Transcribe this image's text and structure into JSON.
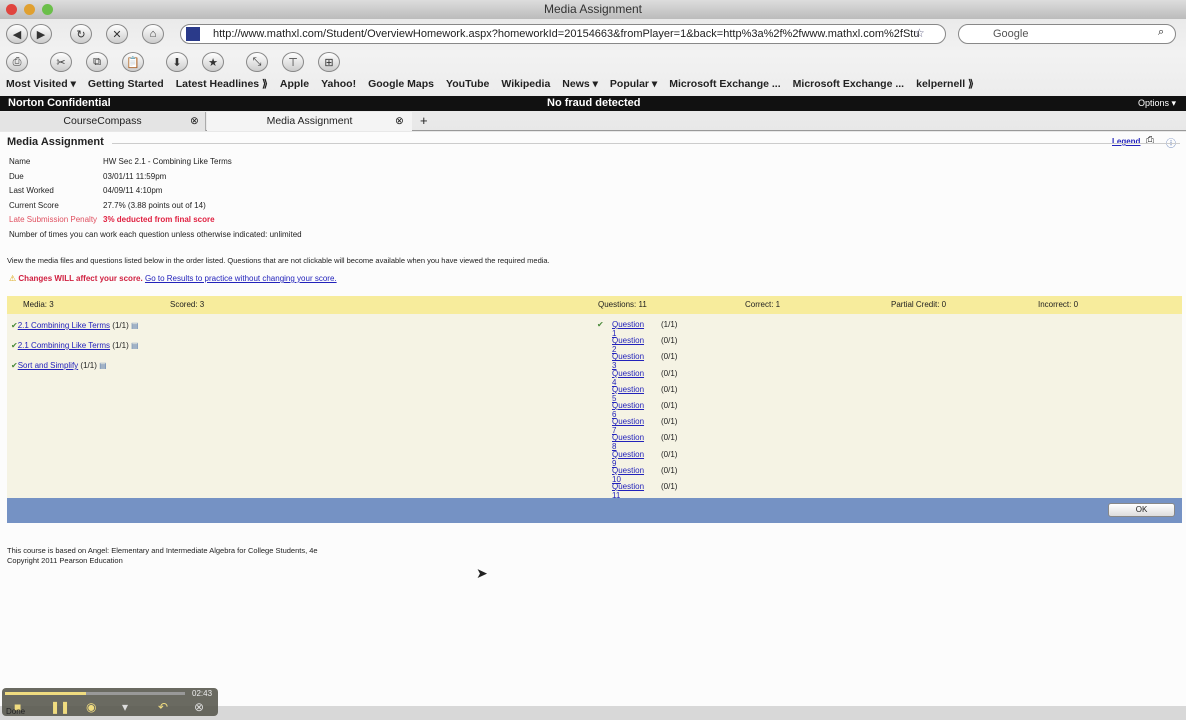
{
  "window": {
    "title": "Media Assignment"
  },
  "nav": {
    "url": "http://www.mathxl.com/Student/OverviewHomework.aspx?homeworkId=20154663&fromPlayer=1&back=http%3a%2f%2fwww.mathxl.com%2fStu",
    "search_placeholder": "Google"
  },
  "bookmarks": [
    "Most Visited ▾",
    "Getting Started",
    "Latest Headlines ⟫",
    "Apple",
    "Yahoo!",
    "Google Maps",
    "YouTube",
    "Wikipedia",
    "News ▾",
    "Popular ▾",
    "Microsoft Exchange ...",
    "Microsoft Exchange ...",
    "kelpernell ⟫"
  ],
  "norton": {
    "title": "Norton Confidential",
    "status": "No fraud detected",
    "options": "Options ▾"
  },
  "tabs": [
    {
      "label": "CourseCompass"
    },
    {
      "label": "Media Assignment"
    }
  ],
  "page": {
    "title": "Media Assignment",
    "legend": "Legend",
    "details": [
      {
        "label": "Name",
        "value": "HW Sec 2.1 - Combining Like Terms"
      },
      {
        "label": "Due",
        "value": "03/01/11 11:59pm"
      },
      {
        "label": "Last Worked",
        "value": "04/09/11 4:10pm"
      },
      {
        "label": "Current Score",
        "value": "27.7% (3.88 points out of 14)"
      },
      {
        "label": "Late Submission Penalty",
        "value": "3% deducted from final score"
      }
    ],
    "attempts": "Number of times you can work each question unless otherwise indicated: unlimited",
    "instructions": "View the media files and questions listed below in the order listed.  Questions that are not clickable will become available when you have viewed the required media.",
    "warning": "Changes WILL affect your score.",
    "warning_link": "Go to Results to practice without changing your score.",
    "summary": {
      "media": "Media: 3",
      "scored": "Scored: 3",
      "questions": "Questions: 11",
      "correct": "Correct: 1",
      "partial": "Partial Credit: 0",
      "incorrect": "Incorrect: 0"
    },
    "media": [
      {
        "title": "2.1 Combining Like Terms",
        "score": "(1/1)"
      },
      {
        "title": "2.1 Combining Like Terms",
        "score": "(1/1)"
      },
      {
        "title": "Sort and Simplify",
        "score": "(1/1)"
      }
    ],
    "questions": [
      {
        "title": "Question 1",
        "score": "(1/1)",
        "done": true
      },
      {
        "title": "Question 2",
        "score": "(0/1)"
      },
      {
        "title": "Question 3",
        "score": "(0/1)"
      },
      {
        "title": "Question 4",
        "score": "(0/1)"
      },
      {
        "title": "Question 5",
        "score": "(0/1)"
      },
      {
        "title": "Question 6",
        "score": "(0/1)"
      },
      {
        "title": "Question 7",
        "score": "(0/1)"
      },
      {
        "title": "Question 8",
        "score": "(0/1)"
      },
      {
        "title": "Question 9",
        "score": "(0/1)"
      },
      {
        "title": "Question 10",
        "score": "(0/1)"
      },
      {
        "title": "Question 11",
        "score": "(0/1)"
      }
    ],
    "ok": "OK",
    "footer1": "This course is based on Angel: Elementary and Intermediate Algebra for College Students, 4e",
    "footer2": "Copyright 2011 Pearson Education"
  },
  "player": {
    "time": "02:43",
    "progress": 0.45,
    "done": "Done"
  }
}
